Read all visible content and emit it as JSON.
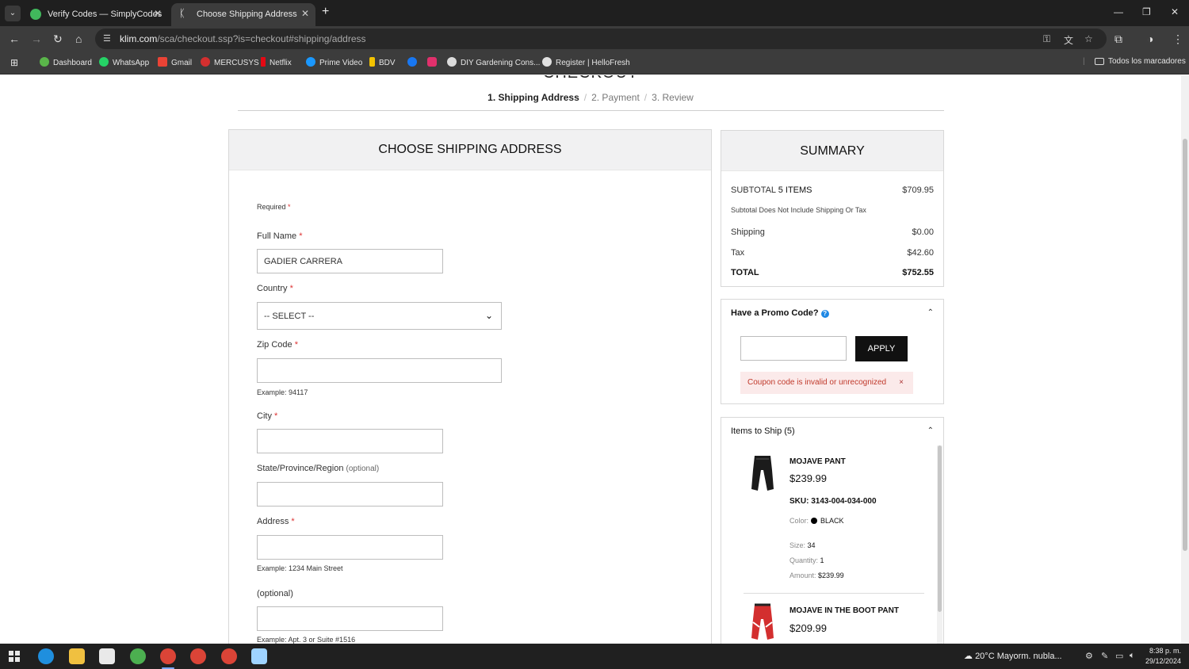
{
  "browser": {
    "tabs": [
      {
        "title": "Verify Codes — SimplyCodes",
        "active": false
      },
      {
        "title": "Choose Shipping Address",
        "active": true
      }
    ],
    "url_host": "klim.com",
    "url_path": "/sca/checkout.ssp?is=checkout#shipping/address",
    "bookmarks": [
      "Dashboard",
      "WhatsApp",
      "Gmail",
      "MERCUSYS",
      "Netflix",
      "Prime Video",
      "BDV",
      "DIY Gardening Cons...",
      "Register | HelloFresh"
    ],
    "all_bookmarks": "Todos los marcadores"
  },
  "page": {
    "heading": "CHECKOUT",
    "steps": [
      "1. Shipping Address",
      "2. Payment",
      "3. Review"
    ]
  },
  "shipping": {
    "title": "CHOOSE SHIPPING ADDRESS",
    "required_note": "Required",
    "full_name_label": "Full Name",
    "full_name_value": "GADIER CARRERA",
    "country_label": "Country",
    "country_value": "-- SELECT --",
    "zip_label": "Zip Code",
    "zip_hint": "Example: 94117",
    "city_label": "City",
    "state_label": "State/Province/Region",
    "state_optional": "(optional)",
    "address_label": "Address",
    "address_hint": "Example: 1234 Main Street",
    "address2_label": "(optional)",
    "address2_hint": "Example: Apt. 3 or Suite #1516"
  },
  "summary": {
    "title": "SUMMARY",
    "subtotal_label": "SUBTOTAL",
    "subtotal_items": "5 ITEMS",
    "subtotal_value": "$709.95",
    "note": "Subtotal Does Not Include Shipping Or Tax",
    "shipping_label": "Shipping",
    "shipping_value": "$0.00",
    "tax_label": "Tax",
    "tax_value": "$42.60",
    "total_label": "TOTAL",
    "total_value": "$752.55"
  },
  "promo": {
    "title": "Have a Promo Code?",
    "apply_label": "APPLY",
    "error": "Coupon code is invalid or unrecognized",
    "error_close": "×"
  },
  "items": {
    "title": "Items to Ship (5)",
    "list": [
      {
        "name": "MOJAVE PANT",
        "price": "$239.99",
        "sku": "SKU: 3143-004-034-000",
        "color_label": "Color:",
        "color": "BLACK",
        "size_label": "Size:",
        "size": "34",
        "qty_label": "Quantity:",
        "qty": "1",
        "amount_label": "Amount:",
        "amount": "$239.99"
      },
      {
        "name": "MOJAVE IN THE BOOT PANT",
        "price": "$209.99"
      }
    ]
  },
  "taskbar": {
    "weather": "20°C  Mayorm. nubla...",
    "time": "8:38 p. m.",
    "date": "29/12/2024"
  },
  "colors": {
    "accent_button": "#111111",
    "error_bg": "#fbeaea",
    "error_text": "#c0392b",
    "required": "#dd3333"
  }
}
